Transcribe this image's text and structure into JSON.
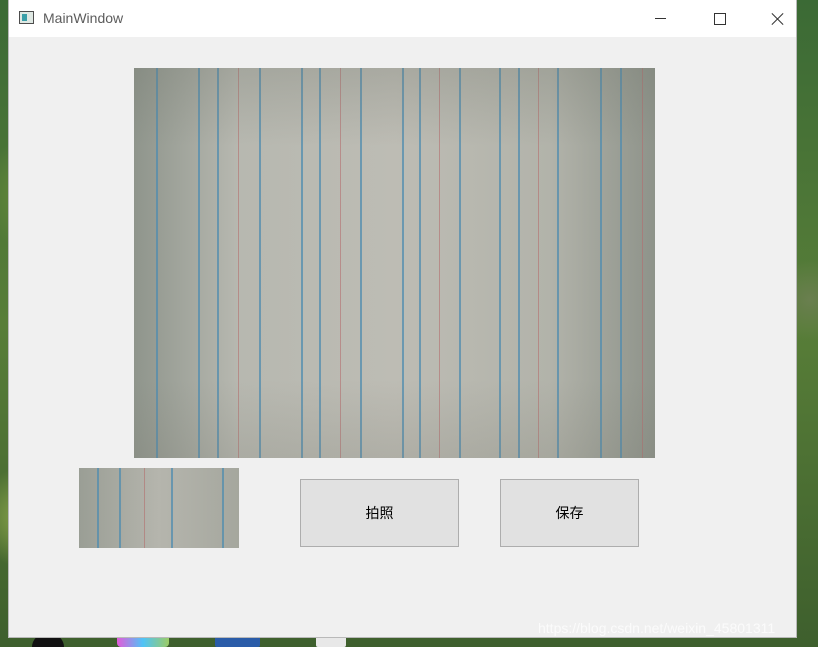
{
  "window": {
    "title": "MainWindow"
  },
  "icons": {
    "app": "window-app-icon",
    "minimize": "minimize-icon",
    "maximize": "maximize-icon",
    "close": "close-icon"
  },
  "main": {
    "camera_preview": "camera-preview",
    "captured_thumbnail": "captured-thumbnail",
    "capture_button_label": "拍照",
    "save_button_label": "保存"
  },
  "colors": {
    "window_bg": "#f0f0f0",
    "button_bg": "#e1e1e1",
    "button_border": "#adadad"
  },
  "watermark": "https://blog.csdn.net/weixin_45801311"
}
